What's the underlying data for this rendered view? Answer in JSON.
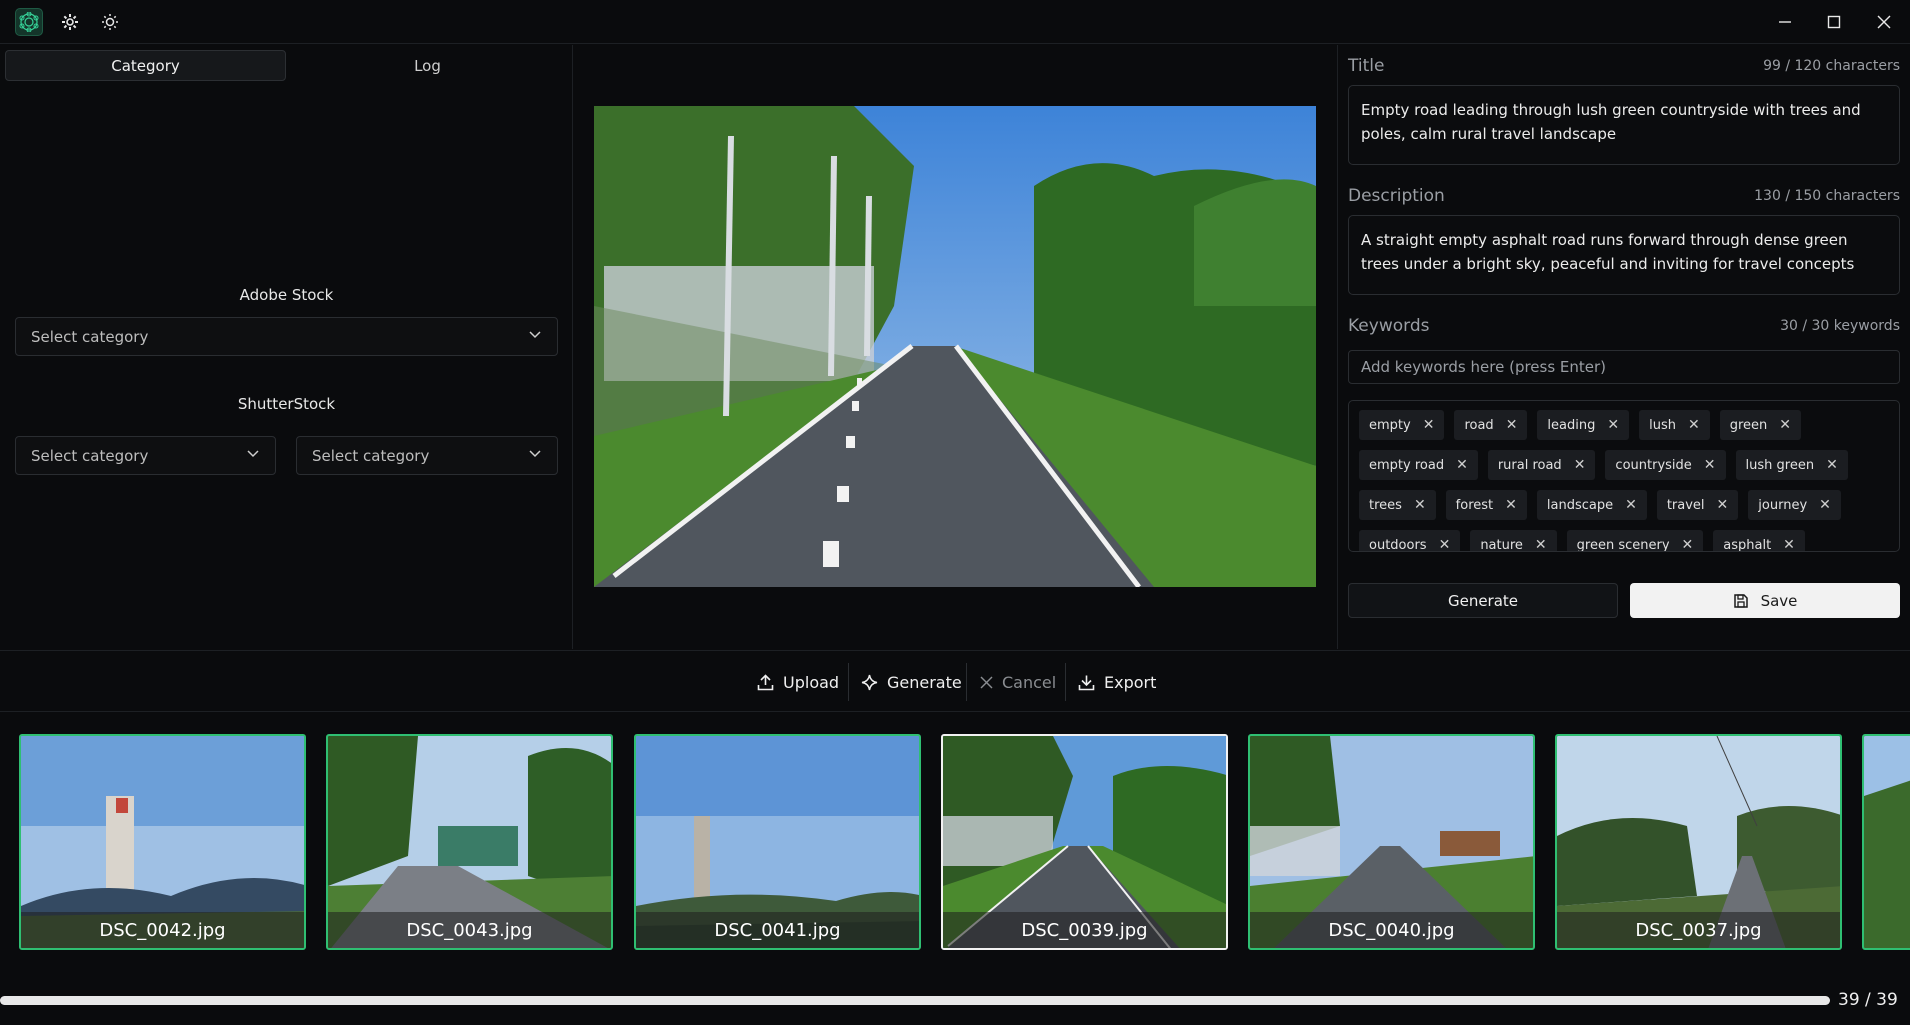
{
  "left_panel": {
    "tabs": [
      "Category",
      "Log"
    ],
    "adobe_label": "Adobe Stock",
    "adobe_select": "Select category",
    "shutter_label": "ShutterStock",
    "shutter_select_1": "Select category",
    "shutter_select_2": "Select category"
  },
  "editor": {
    "title_label": "Title",
    "title_count": "99 / 120 characters",
    "title_text": "Empty road leading through lush green countryside with trees and poles, calm rural travel landscape",
    "description_label": "Description",
    "description_count": "130 / 150 characters",
    "description_text": "A straight empty asphalt road runs forward through dense green trees under a bright sky, peaceful and inviting for travel concepts",
    "keywords_label": "Keywords",
    "keywords_count": "30 / 30 keywords",
    "keywords_placeholder": "Add keywords here (press Enter)",
    "keyword_rows": [
      [
        "empty",
        "road",
        "leading",
        "lush",
        "green"
      ],
      [
        "empty road",
        "rural road",
        "countryside",
        "lush green"
      ],
      [
        "trees",
        "forest",
        "landscape",
        "travel",
        "journey"
      ],
      [
        "outdoors",
        "nature",
        "green scenery",
        "asphalt"
      ]
    ],
    "generate_label": "Generate",
    "save_label": "Save"
  },
  "toolbar": {
    "upload": "Upload",
    "generate": "Generate",
    "cancel": "Cancel",
    "export": "Export"
  },
  "thumbnails": [
    "DSC_0042.jpg",
    "DSC_0043.jpg",
    "DSC_0041.jpg",
    "DSC_0039.jpg",
    "DSC_0040.jpg",
    "DSC_0037.jpg"
  ],
  "selected_thumbnail": "DSC_0039.jpg",
  "progress": {
    "label": "39 / 39",
    "fraction": 1.0
  },
  "colors": {
    "accent_green": "#2fbf72",
    "background": "#0a0b0d",
    "save_bg": "#f2f2f2"
  }
}
